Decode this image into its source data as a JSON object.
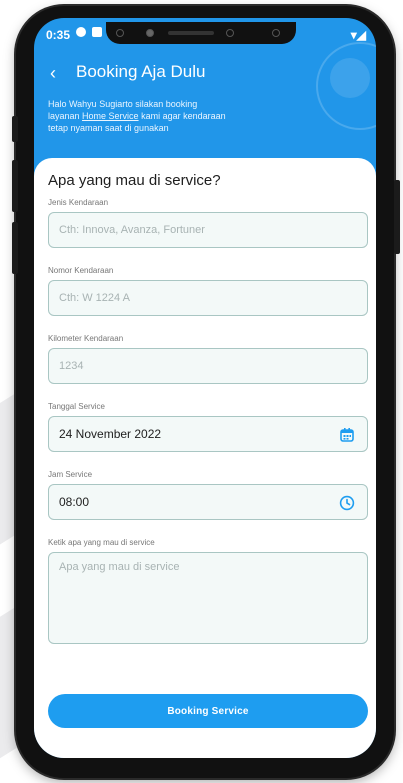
{
  "status_bar": {
    "time": "0:35",
    "right_text": "▾◢"
  },
  "header": {
    "title": "Booking Aja Dulu",
    "intro_line1": "Halo Wahyu Sugiarto silakan booking",
    "intro_pre": "layanan ",
    "intro_link": "Home Service",
    "intro_post": " kami agar kendaraan",
    "intro_line3": "tetap nyaman saat di gunakan"
  },
  "form": {
    "title": "Apa yang mau di service?",
    "vehicle_type": {
      "label": "Jenis Kendaraan",
      "placeholder": "Cth: Innova, Avanza, Fortuner"
    },
    "plate": {
      "label": "Nomor Kendaraan",
      "placeholder": "Cth: W 1224 A"
    },
    "odometer": {
      "label": "Kilometer Kendaraan",
      "placeholder": "1234"
    },
    "date": {
      "label": "Tanggal Service",
      "value": "24 November 2022"
    },
    "time": {
      "label": "Jam Service",
      "value": "08:00"
    },
    "notes": {
      "label": "Ketik apa yang mau di service",
      "placeholder": "Apa yang mau di service"
    },
    "submit_label": "Booking Service"
  },
  "colors": {
    "accent": "#2196E9",
    "field_bg": "#F3F9F8",
    "field_border": "#A9C6C3"
  }
}
